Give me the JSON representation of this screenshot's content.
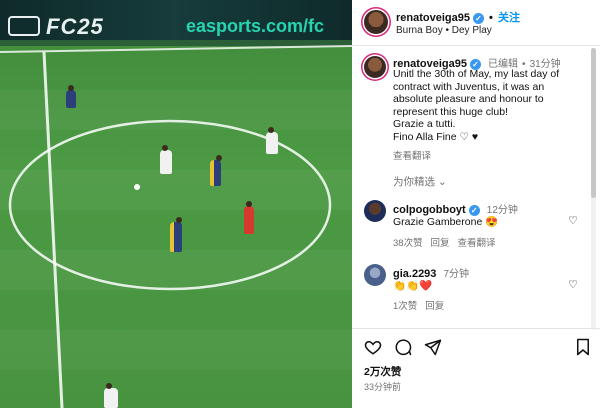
{
  "media": {
    "board_logo": "FC25",
    "board_url": "easports.com/fc"
  },
  "header": {
    "username": "renatoveiga95",
    "follow_label": "关注",
    "follow_separator": "•",
    "song": "Burna Boy • Dey Play",
    "more": "···"
  },
  "post": {
    "username": "renatoveiga95",
    "edited": "已编辑",
    "separator": "•",
    "age": "31分钟",
    "caption_lines": [
      "Unitl the 30th of May, my last day of",
      "contract with Juventus, it was an",
      "absolute pleasure and honour to",
      "represent this huge club!",
      "Grazie a tutti.",
      "Fino Alla Fine ♡ ♥"
    ],
    "translate": "查看翻译"
  },
  "filter": {
    "label": "为你精选",
    "chevron": "⌄"
  },
  "comments": [
    {
      "username": "colpogobboyt",
      "age": "12分钟",
      "text": "Grazie Gamberone 😍",
      "likes": "38次赞",
      "reply": "回复",
      "translate": "查看翻译"
    },
    {
      "username": "gia.2293",
      "age": "7分钟",
      "text": "👏👏❤️",
      "likes": "1次赞",
      "reply": "回复"
    }
  ],
  "footer": {
    "likes": "2万次赞",
    "time": "33分钟前"
  },
  "colors": {
    "accent": "#0095f6",
    "verified": "#3897f0",
    "pitch": "#4c9a44",
    "board": "#163c3b",
    "board_text": "#27d3b0"
  },
  "icons": {
    "like": "heart-outline-icon",
    "comment": "comment-bubble-icon",
    "share": "paper-plane-icon",
    "save": "bookmark-icon",
    "verified": "verified-badge-icon"
  }
}
